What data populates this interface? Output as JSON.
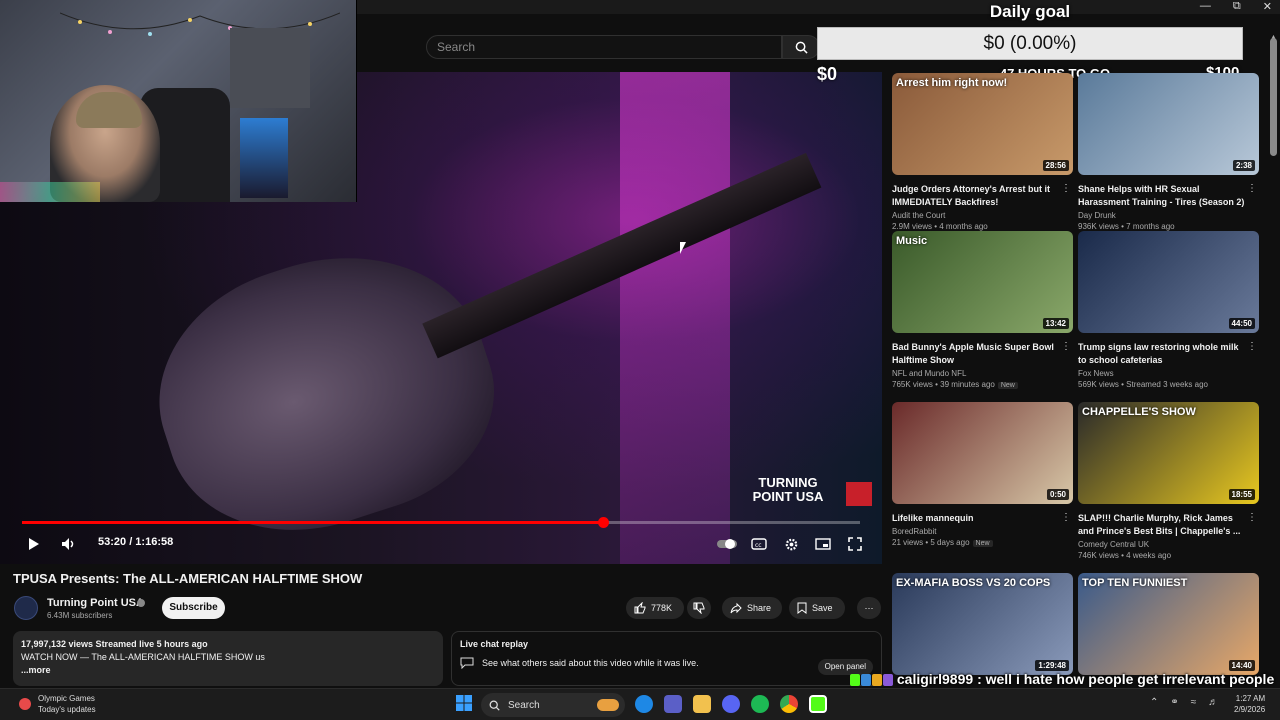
{
  "search": {
    "placeholder": "Search"
  },
  "goal": {
    "title": "Daily goal",
    "amount": "$0 (0.00%)",
    "min": "$0",
    "time_left": "47 HOURS TO GO",
    "max": "$100",
    "progress_fraction": 0.0
  },
  "player": {
    "time": "53:20 / 1:16:58",
    "progress_fraction": 0.693,
    "watermark": "TURNING POINT USA"
  },
  "video": {
    "title": "TPUSA Presents: The ALL-AMERICAN HALFTIME SHOW",
    "channel": "Turning Point USA",
    "subscribers": "6.43M subscribers",
    "subscribe_label": "Subscribe",
    "likes": "778K",
    "share_label": "Share",
    "save_label": "Save",
    "stats": "17,997,132 views  Streamed live 5 hours ago",
    "description": "WATCH NOW — The ALL-AMERICAN HALFTIME SHOW us",
    "more_label": "...more"
  },
  "live_chat": {
    "title": "Live chat replay",
    "text": "See what others said about this video while it was live.",
    "button": "Open panel"
  },
  "recommendations": [
    {
      "title": "Judge Orders Attorney's Arrest but it IMMEDIATELY Backfires!",
      "channel": "Audit the Court",
      "meta": "2.9M views • 4 months ago",
      "duration": "28:56",
      "overlay": "Arrest him right now!",
      "colors": [
        "#8a5a3a",
        "#c89a6a"
      ],
      "badge": ""
    },
    {
      "title": "Shane Helps with HR Sexual Harassment Training - Tires (Season 2)",
      "channel": "Day Drunk",
      "meta": "936K views • 7 months ago",
      "duration": "2:38",
      "overlay": "",
      "colors": [
        "#5a7a9a",
        "#b8c8d8"
      ],
      "badge": ""
    },
    {
      "title": "Bad Bunny's Apple Music Super Bowl Halftime Show",
      "channel": "NFL and Mundo NFL",
      "meta": "765K views • 39 minutes ago",
      "duration": "13:42",
      "overlay": "Music",
      "colors": [
        "#3a5a2a",
        "#8aa86a"
      ],
      "badge": "New"
    },
    {
      "title": "Trump signs law restoring whole milk to school cafeterias",
      "channel": "Fox News",
      "meta": "569K views • Streamed 3 weeks ago",
      "duration": "44:50",
      "overlay": "",
      "colors": [
        "#1a2a4a",
        "#6a7a9a"
      ],
      "badge": ""
    },
    {
      "title": "Lifelike mannequin",
      "channel": "BoredRabbit",
      "meta": "21 views • 5 days ago",
      "duration": "0:50",
      "overlay": "",
      "colors": [
        "#6a2a2a",
        "#d8c8a8"
      ],
      "badge": "New"
    },
    {
      "title": "SLAP!!! Charlie Murphy, Rick James and Prince's Best Bits | Chappelle's ...",
      "channel": "Comedy Central UK",
      "meta": "746K views • 4 weeks ago",
      "duration": "18:55",
      "overlay": "CHAPPELLE'S SHOW",
      "colors": [
        "#2a2a2a",
        "#e8c820"
      ],
      "badge": ""
    },
    {
      "title": "",
      "channel": "",
      "meta": "",
      "duration": "1:29:48",
      "overlay": "EX-MAFIA BOSS VS 20 COPS",
      "colors": [
        "#2a3a5a",
        "#8a9aba"
      ],
      "badge": ""
    },
    {
      "title": "",
      "channel": "",
      "meta": "",
      "duration": "14:40",
      "overlay": "TOP TEN FUNNIEST",
      "colors": [
        "#3a5a8a",
        "#e8a868"
      ],
      "badge": ""
    }
  ],
  "chat": {
    "user": "caligirl9899",
    "message": ": well i hate how people get irrelevant people into the shit"
  },
  "taskbar": {
    "weather_title": "Olympic Games",
    "weather_sub": "Today's updates",
    "search": "Search",
    "time": "1:27 AM",
    "date": "2/9/2026"
  }
}
